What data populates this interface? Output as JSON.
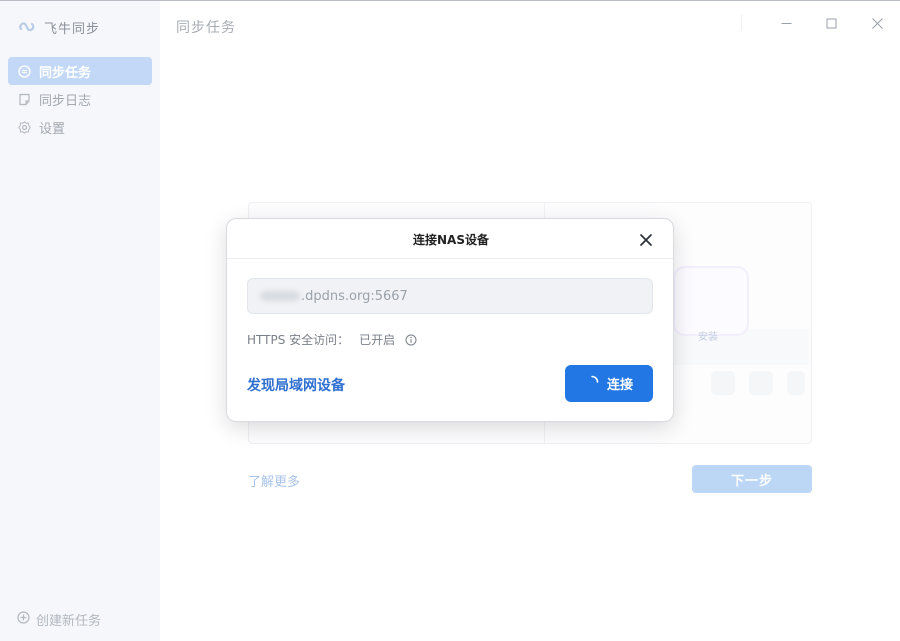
{
  "app": {
    "name": "飞牛同步"
  },
  "sidebar": {
    "items": [
      {
        "label": "同步任务",
        "icon": "sync-circle-icon",
        "active": true
      },
      {
        "label": "同步日志",
        "icon": "log-note-icon",
        "active": false
      },
      {
        "label": "设置",
        "icon": "gear-icon",
        "active": false
      }
    ],
    "create_task": "创建新任务"
  },
  "header": {
    "title": "同步任务"
  },
  "background": {
    "learn_more": "了解更多",
    "next_label": "下一步",
    "illustration_label": "安装"
  },
  "dialog": {
    "title": "连接NAS设备",
    "address_suffix": ".dpdns.org:5667",
    "https_label": "HTTPS 安全访问：",
    "https_status": "已开启",
    "discover_label": "发现局域网设备",
    "connect_label": "连接"
  },
  "colors": {
    "accent": "#2277e4",
    "sidebar_active": "#c2d8f6",
    "link": "#2f6fd0"
  }
}
